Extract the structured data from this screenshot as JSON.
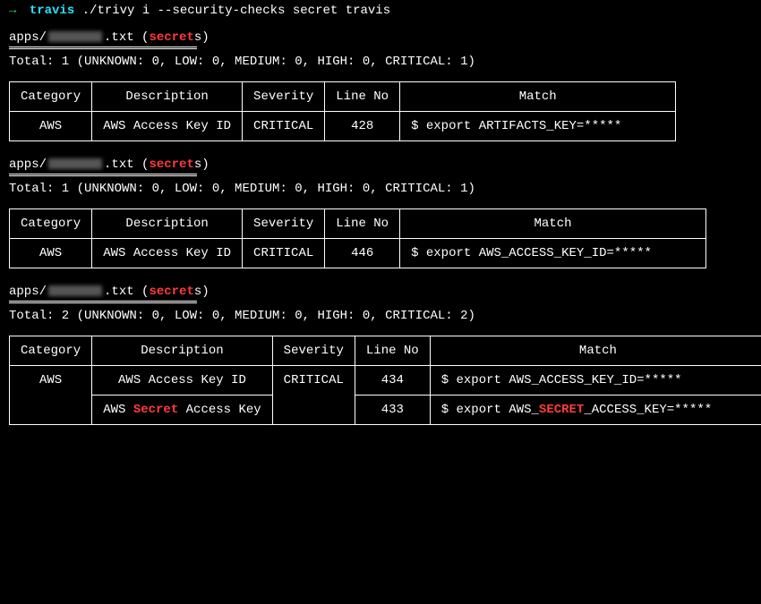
{
  "prompt": {
    "arrow": "→",
    "dir": "travis",
    "cmd": "./trivy i  --security-checks secret travis"
  },
  "sections": [
    {
      "file_prefix": "apps/",
      "file_suffix": ".txt",
      "secret_label_pre": "secret",
      "secret_label_post": "s",
      "total": "Total: 1 (UNKNOWN: 0, LOW: 0, MEDIUM: 0, HIGH: 0, CRITICAL: 1)",
      "headers": [
        "Category",
        "Description",
        "Severity",
        "Line No",
        "Match"
      ],
      "rows": [
        {
          "category": "AWS",
          "description": "AWS Access Key ID",
          "severity": "CRITICAL",
          "line": "428",
          "match": "$ export ARTIFACTS_KEY=*****"
        }
      ]
    },
    {
      "file_prefix": "apps/",
      "file_suffix": ".txt",
      "secret_label_pre": "secret",
      "secret_label_post": "s",
      "total": "Total: 1 (UNKNOWN: 0, LOW: 0, MEDIUM: 0, HIGH: 0, CRITICAL: 1)",
      "headers": [
        "Category",
        "Description",
        "Severity",
        "Line No",
        "Match"
      ],
      "rows": [
        {
          "category": "AWS",
          "description": "AWS Access Key ID",
          "severity": "CRITICAL",
          "line": "446",
          "match": "$ export AWS_ACCESS_KEY_ID=*****"
        }
      ]
    },
    {
      "file_prefix": "apps/",
      "file_suffix": ".txt",
      "secret_label_pre": "secret",
      "secret_label_post": "s",
      "total": "Total: 2 (UNKNOWN: 0, LOW: 0, MEDIUM: 0, HIGH: 0, CRITICAL: 2)",
      "headers": [
        "Category",
        "Description",
        "Severity",
        "Line No",
        "Match"
      ],
      "merged_category": "AWS",
      "merged_severity": "CRITICAL",
      "rows": [
        {
          "description": "AWS Access Key ID",
          "line": "434",
          "match": "$ export AWS_ACCESS_KEY_ID=*****"
        },
        {
          "description_pre": "AWS ",
          "description_red": "Secret",
          "description_post": " Access Key",
          "line": "433",
          "match_pre": "$ export AWS_",
          "match_red": "SECRET",
          "match_post": "_ACCESS_KEY=*****"
        }
      ]
    }
  ]
}
